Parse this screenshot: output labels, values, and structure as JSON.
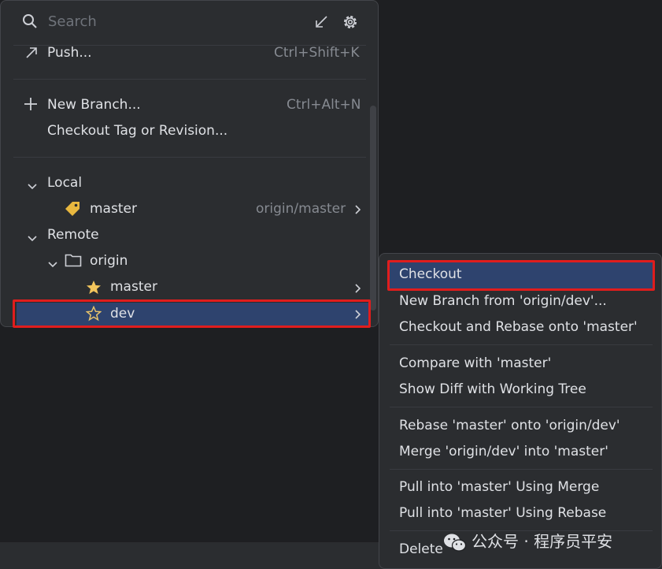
{
  "search": {
    "placeholder": "Search"
  },
  "actions": {
    "push": {
      "label": "Push...",
      "shortcut": "Ctrl+Shift+K"
    },
    "new_branch": {
      "label": "New Branch...",
      "shortcut": "Ctrl+Alt+N"
    },
    "checkout_tag": {
      "label": "Checkout Tag or Revision..."
    }
  },
  "tree": {
    "local": {
      "label": "Local",
      "branches": [
        {
          "name": "master",
          "tracking": "origin/master"
        }
      ]
    },
    "remote": {
      "label": "Remote",
      "remotes": [
        {
          "name": "origin",
          "branches": [
            {
              "name": "master",
              "favorite": true
            },
            {
              "name": "dev",
              "favorite": false,
              "selected": true
            }
          ]
        }
      ]
    }
  },
  "context_menu": {
    "items": [
      "Checkout",
      "New Branch from 'origin/dev'...",
      "Checkout and Rebase onto 'master'",
      "Compare with 'master'",
      "Show Diff with Working Tree",
      "Rebase 'master' onto 'origin/dev'",
      "Merge 'origin/dev' into 'master'",
      "Pull into 'master' Using Merge",
      "Pull into 'master' Using Rebase",
      "Delete"
    ],
    "selected_index": 0
  },
  "watermark": {
    "text": "公众号 · 程序员平安"
  },
  "colors": {
    "selection": "#2e436e",
    "highlight_box": "#e01d1d",
    "star": "#f2c55c",
    "tag": "#e8b73f"
  }
}
